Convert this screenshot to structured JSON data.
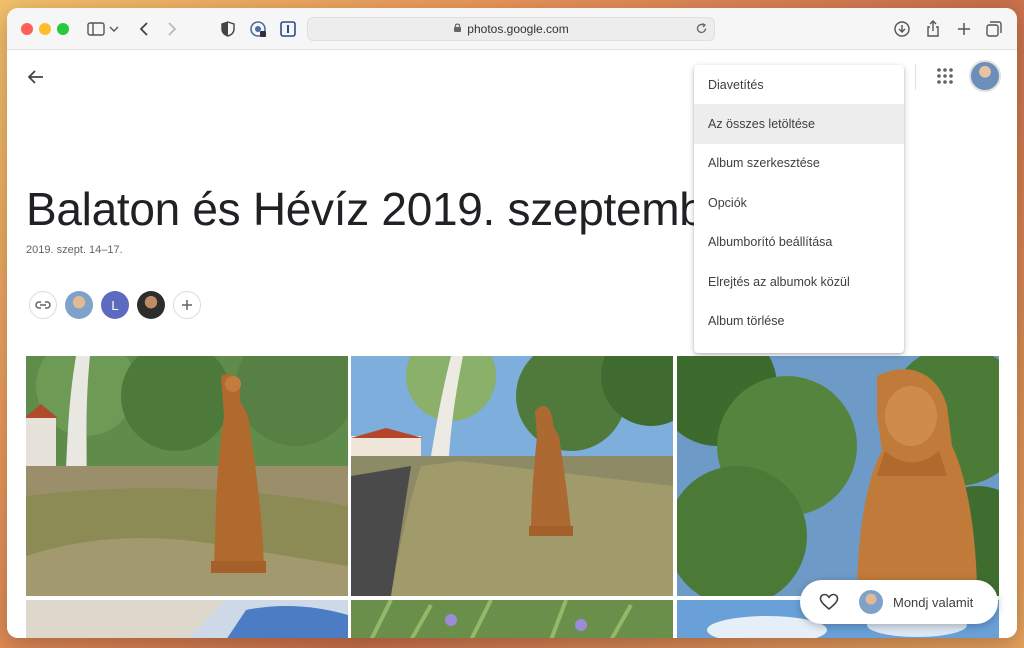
{
  "browser": {
    "url": "photos.google.com"
  },
  "album": {
    "title": "Balaton és Hévíz 2019. szeptember",
    "date": "2019. szept. 14–17.",
    "member_initial": "L"
  },
  "menu": {
    "items": [
      {
        "label": "Diavetítés"
      },
      {
        "label": "Az összes letöltése"
      },
      {
        "label": "Album szerkesztése"
      },
      {
        "label": "Opciók"
      },
      {
        "label": "Albumborító beállítása"
      },
      {
        "label": "Elrejtés az albumok közül"
      },
      {
        "label": "Album törlése"
      }
    ],
    "active_index": 1
  },
  "comment": {
    "placeholder": "Mondj valamit"
  },
  "icons": {
    "back": "arrow-left-icon",
    "apps": "apps-grid-icon",
    "link": "link-icon",
    "add": "plus-icon",
    "heart": "heart-icon"
  },
  "colors": {
    "accent_member": "#5c6bc0",
    "menu_active_bg": "#ededed"
  }
}
